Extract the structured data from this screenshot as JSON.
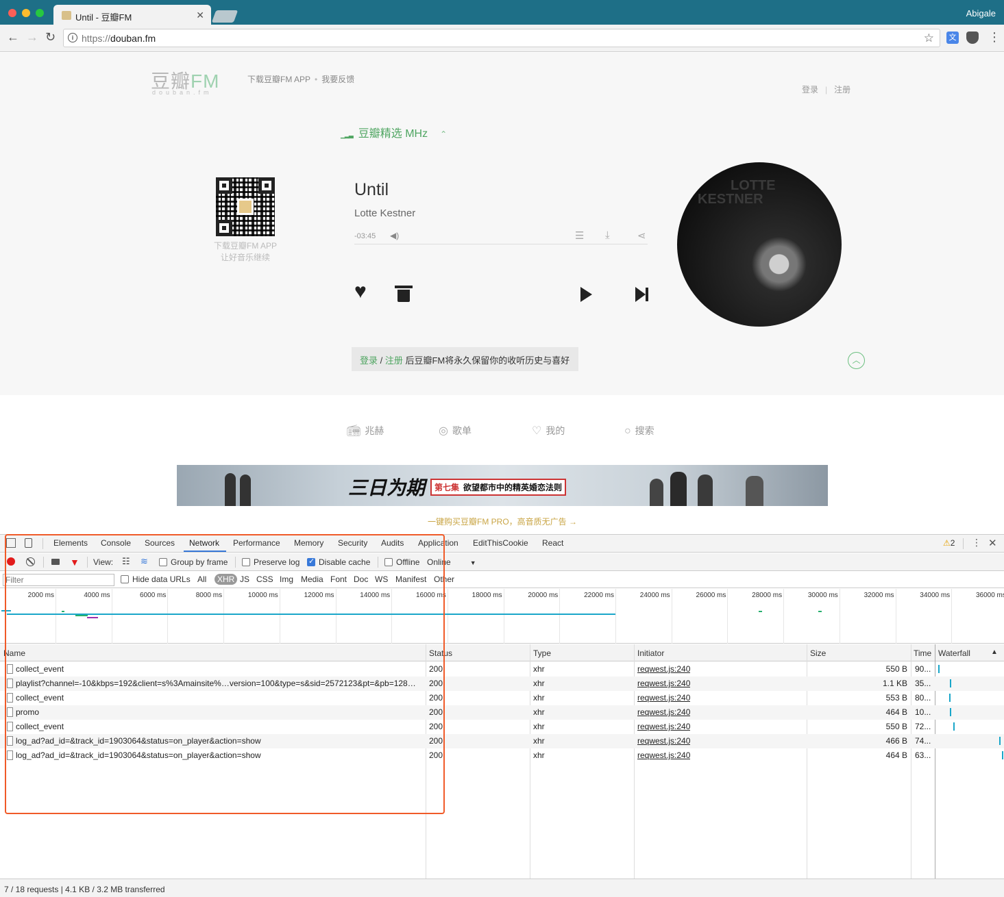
{
  "browser": {
    "tab_title": "Until - 豆瓣FM",
    "profile_name": "Abigale",
    "url_scheme": "https://",
    "url_host": "douban.fm"
  },
  "site": {
    "logo_main": "豆瓣",
    "logo_fm": "FM",
    "logo_sub": "douban.fm",
    "header_link_app": "下载豆瓣FM APP",
    "header_link_feedback": "我要反馈",
    "login": "登录",
    "register": "注册",
    "channel_name": "豆瓣精选 MHz",
    "qr_caption_1": "下载豆瓣FM APP",
    "qr_caption_2": "让好音乐继续",
    "song_title": "Until",
    "song_artist": "Lotte Kestner",
    "time_remaining": "-03:45",
    "album_text_1": "LOTTE",
    "album_text_2": "KESTNER",
    "login_hint_login": "登录",
    "login_hint_sep": " / ",
    "login_hint_register": "注册",
    "login_hint_rest": " 后豆瓣FM将永久保留你的收听历史与喜好",
    "nav": {
      "mhz": "兆赫",
      "playlist": "歌单",
      "mine": "我的",
      "search": "搜索"
    },
    "ad_brand": "三日为期",
    "ad_episode": "第七集",
    "ad_slogan": "欲望都市中的精英婚恋法则",
    "ad_promo": "一键购买豆瓣FM PRO，高音质无广告 →"
  },
  "devtools": {
    "tabs": [
      "Elements",
      "Console",
      "Sources",
      "Network",
      "Performance",
      "Memory",
      "Security",
      "Audits",
      "Application",
      "EditThisCookie",
      "React"
    ],
    "active_tab": "Network",
    "warning_count": "2",
    "toolbar": {
      "view_label": "View:",
      "group_by_frame": "Group by frame",
      "preserve_log": "Preserve log",
      "disable_cache": "Disable cache",
      "offline": "Offline",
      "throttle": "Online"
    },
    "filter_placeholder": "Filter",
    "hide_data_urls": "Hide data URLs",
    "filter_types": [
      "All",
      "XHR",
      "JS",
      "CSS",
      "Img",
      "Media",
      "Font",
      "Doc",
      "WS",
      "Manifest",
      "Other"
    ],
    "active_filter": "XHR",
    "timeline_ticks": [
      "2000 ms",
      "4000 ms",
      "6000 ms",
      "8000 ms",
      "10000 ms",
      "12000 ms",
      "14000 ms",
      "16000 ms",
      "18000 ms",
      "20000 ms",
      "22000 ms",
      "24000 ms",
      "26000 ms",
      "28000 ms",
      "30000 ms",
      "32000 ms",
      "34000 ms",
      "36000 ms"
    ],
    "columns": {
      "name": "Name",
      "status": "Status",
      "type": "Type",
      "initiator": "Initiator",
      "size": "Size",
      "time": "Time",
      "waterfall": "Waterfall"
    },
    "requests": [
      {
        "name": "collect_event",
        "status": "200",
        "type": "xhr",
        "initiator": "reqwest.js:240",
        "size": "550 B",
        "time": "90..."
      },
      {
        "name": "playlist?channel=-10&kbps=192&client=s%3Amainsite%…version=100&type=s&sid=2572123&pt=&pb=128…",
        "status": "200",
        "type": "xhr",
        "initiator": "reqwest.js:240",
        "size": "1.1 KB",
        "time": "35..."
      },
      {
        "name": "collect_event",
        "status": "200",
        "type": "xhr",
        "initiator": "reqwest.js:240",
        "size": "553 B",
        "time": "80..."
      },
      {
        "name": "promo",
        "status": "200",
        "type": "xhr",
        "initiator": "reqwest.js:240",
        "size": "464 B",
        "time": "10..."
      },
      {
        "name": "collect_event",
        "status": "200",
        "type": "xhr",
        "initiator": "reqwest.js:240",
        "size": "550 B",
        "time": "72..."
      },
      {
        "name": "log_ad?ad_id=&track_id=1903064&status=on_player&action=show",
        "status": "200",
        "type": "xhr",
        "initiator": "reqwest.js:240",
        "size": "466 B",
        "time": "74..."
      },
      {
        "name": "log_ad?ad_id=&track_id=1903064&status=on_player&action=show",
        "status": "200",
        "type": "xhr",
        "initiator": "reqwest.js:240",
        "size": "464 B",
        "time": "63..."
      }
    ],
    "summary": "7 / 18 requests | 4.1 KB / 3.2 MB transferred"
  },
  "colors": {
    "accent_green": "#4fa561",
    "devtools_blue": "#3879d9",
    "highlight_orange": "#f05a28",
    "chrome_teal": "#1e6f87"
  }
}
